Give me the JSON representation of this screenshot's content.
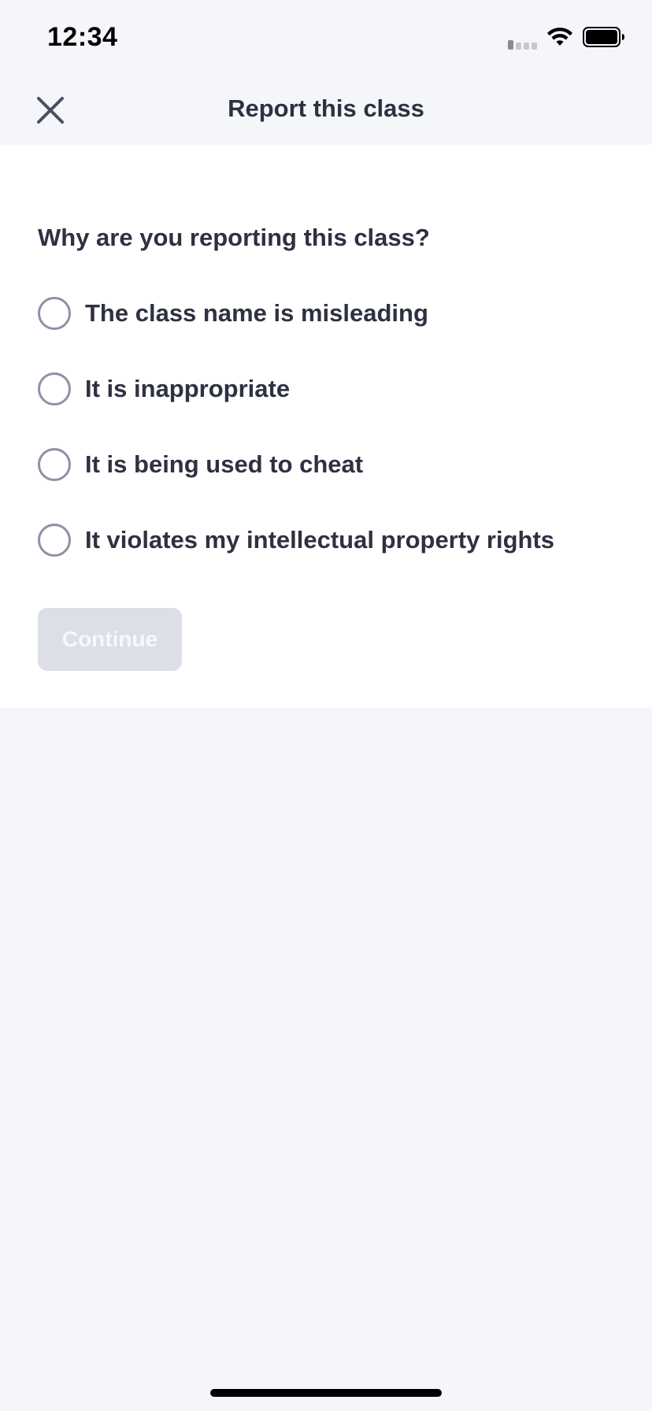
{
  "status_bar": {
    "time": "12:34",
    "icons": [
      "signal-icon",
      "wifi-icon",
      "battery-icon"
    ]
  },
  "header": {
    "close_icon": "close-icon",
    "title": "Report this class"
  },
  "form": {
    "question": "Why are you reporting this class?",
    "options": [
      {
        "label": "The class name is misleading",
        "selected": false
      },
      {
        "label": "It is inappropriate",
        "selected": false
      },
      {
        "label": "It is being used to cheat",
        "selected": false
      },
      {
        "label": "It violates my intellectual property rights",
        "selected": false
      }
    ],
    "continue_label": "Continue",
    "continue_enabled": false
  },
  "colors": {
    "background": "#f5f6fa",
    "card": "#ffffff",
    "text": "#2e3140",
    "radio_border": "#8e91a5",
    "button_disabled_bg": "#dcdee8",
    "button_disabled_text": "#f7f8fb"
  }
}
